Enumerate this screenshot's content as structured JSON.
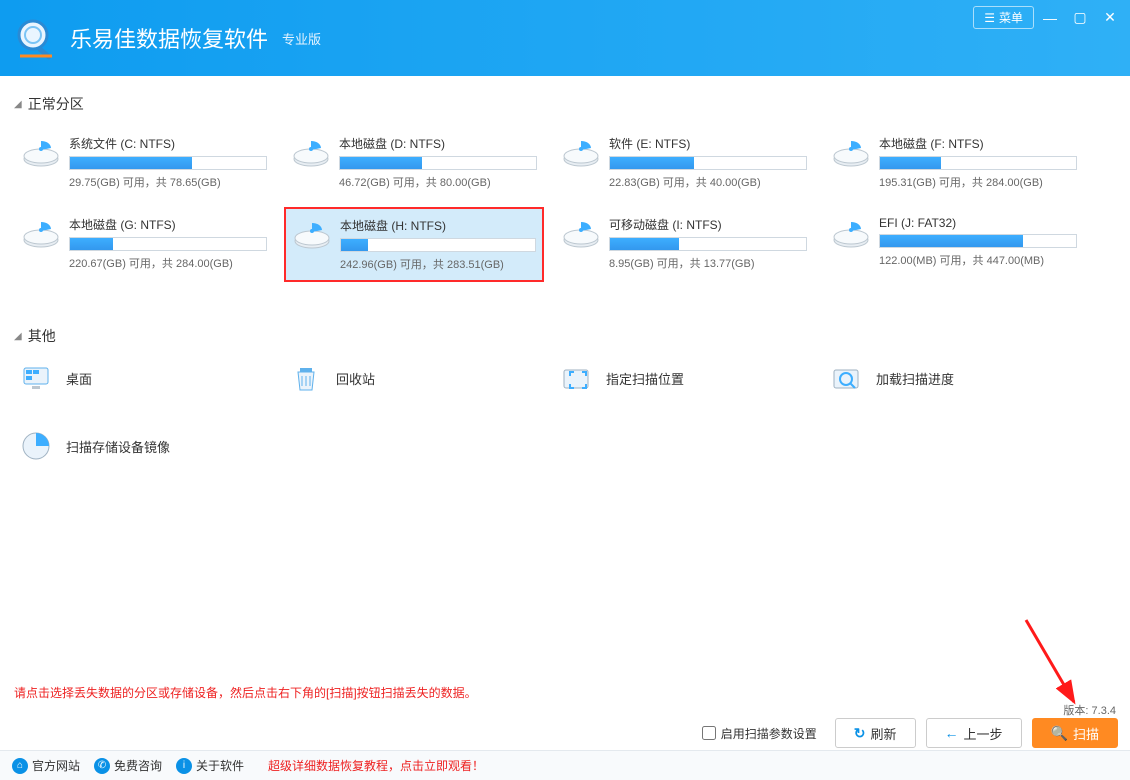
{
  "header": {
    "title": "乐易佳数据恢复软件",
    "subtitle": "专业版",
    "menu_label": "菜单"
  },
  "sections": {
    "partitions_title": "正常分区",
    "others_title": "其他"
  },
  "partitions": [
    {
      "name": "系统文件 (C: NTFS)",
      "fill": 62,
      "usage": "29.75(GB) 可用，共 78.65(GB)"
    },
    {
      "name": "本地磁盘 (D: NTFS)",
      "fill": 42,
      "usage": "46.72(GB) 可用，共 80.00(GB)"
    },
    {
      "name": "软件 (E: NTFS)",
      "fill": 43,
      "usage": "22.83(GB) 可用，共 40.00(GB)"
    },
    {
      "name": "本地磁盘 (F: NTFS)",
      "fill": 31,
      "usage": "195.31(GB) 可用，共 284.00(GB)"
    },
    {
      "name": "本地磁盘 (G: NTFS)",
      "fill": 22,
      "usage": "220.67(GB) 可用，共 284.00(GB)"
    },
    {
      "name": "本地磁盘 (H: NTFS)",
      "fill": 14,
      "usage": "242.96(GB) 可用，共 283.51(GB)",
      "selected": true
    },
    {
      "name": "可移动磁盘 (I: NTFS)",
      "fill": 35,
      "usage": "8.95(GB) 可用，共 13.77(GB)"
    },
    {
      "name": "EFI (J: FAT32)",
      "fill": 73,
      "usage": "122.00(MB) 可用，共 447.00(MB)"
    }
  ],
  "others": [
    {
      "label": "桌面",
      "icon": "desktop"
    },
    {
      "label": "回收站",
      "icon": "recycle"
    },
    {
      "label": "指定扫描位置",
      "icon": "target"
    },
    {
      "label": "加载扫描进度",
      "icon": "load"
    },
    {
      "label": "扫描存储设备镜像",
      "icon": "image"
    }
  ],
  "hint": "请点击选择丢失数据的分区或存储设备，然后点击右下角的[扫描]按钮扫描丢失的数据。",
  "bottom": {
    "checkbox_label": "启用扫描参数设置",
    "refresh": "刷新",
    "back": "上一步",
    "scan": "扫描"
  },
  "version_label": "版本: 7.3.4",
  "footer": {
    "website": "官方网站",
    "consult": "免费咨询",
    "about": "关于软件",
    "tutorial": "超级详细数据恢复教程，点击立即观看！"
  }
}
